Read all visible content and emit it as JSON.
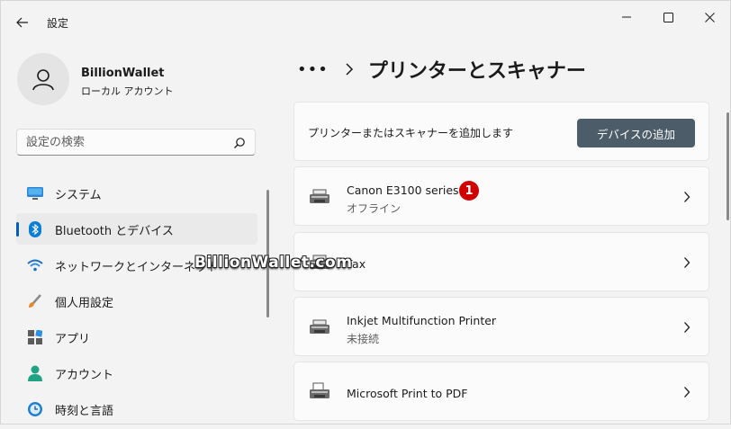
{
  "window": {
    "title": "設定"
  },
  "profile": {
    "name": "BillionWallet",
    "account_type": "ローカル アカウント"
  },
  "search": {
    "placeholder": "設定の検索"
  },
  "sidebar": {
    "items": [
      {
        "label": "システム",
        "icon": "system-icon"
      },
      {
        "label": "Bluetooth とデバイス",
        "icon": "bluetooth-icon",
        "selected": true
      },
      {
        "label": "ネットワークとインターネット",
        "icon": "wifi-icon"
      },
      {
        "label": "個人用設定",
        "icon": "brush-icon"
      },
      {
        "label": "アプリ",
        "icon": "apps-icon"
      },
      {
        "label": "アカウント",
        "icon": "account-icon"
      },
      {
        "label": "時刻と言語",
        "icon": "time-language-icon"
      }
    ]
  },
  "breadcrumb": {
    "more": "•••",
    "title": "プリンターとスキャナー"
  },
  "add_device": {
    "text": "プリンターまたはスキャナーを追加します",
    "button_label": "デバイスの追加"
  },
  "devices": [
    {
      "name": "Canon E3100 series",
      "status": "オフライン",
      "badge": "1"
    },
    {
      "name": "Fax",
      "status": ""
    },
    {
      "name": "Inkjet Multifunction Printer",
      "status": "未接続"
    },
    {
      "name": "Microsoft Print to PDF",
      "status": ""
    }
  ],
  "watermark": "BillionWallet.com",
  "colors": {
    "accent": "#005fb8",
    "button": "#4c5c68",
    "badge": "#d00000"
  }
}
